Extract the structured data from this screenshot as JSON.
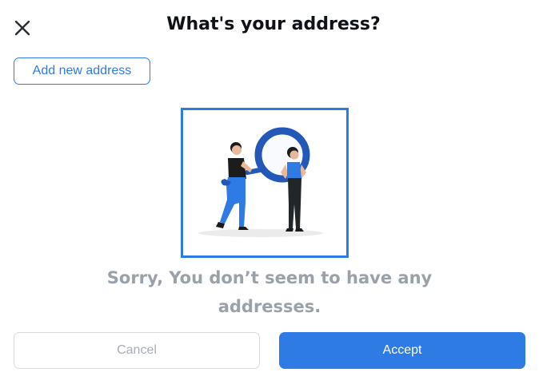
{
  "dialog": {
    "title": "What's your address?",
    "close_icon": "close-icon",
    "add_button_label": "Add new address",
    "empty_state": {
      "illustration": "people-with-magnifying-glass-illustration",
      "message": "Sorry, You don’t seem to have any addresses."
    },
    "cancel_label": "Cancel",
    "accept_label": "Accept"
  },
  "colors": {
    "accent": "#2f7be5",
    "title_text": "#0f1216",
    "muted_text": "#9aa1a9",
    "disabled_border": "#d7dadf"
  }
}
